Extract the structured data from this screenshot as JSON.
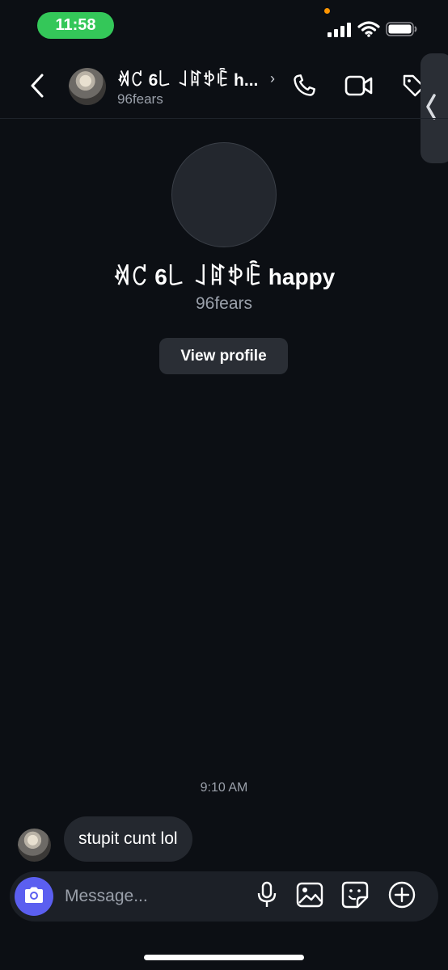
{
  "status_bar": {
    "time": "11:58"
  },
  "header": {
    "name": "ꄊ꒝ 6꒒ ꒑ꍏꉣꍟ h...",
    "chevron": "›",
    "username": "96fears",
    "icons": [
      "chevron-left-icon",
      "phone-icon",
      "video-icon",
      "tag-icon"
    ]
  },
  "profile": {
    "name": "ꄊ꒝ 6꒒ ꒑ꍏꉣꍟ happy",
    "username": "96fears",
    "view_profile_label": "View profile"
  },
  "conversation": {
    "timestamp": "9:10 AM",
    "messages": [
      {
        "text": "stupit cunt lol",
        "from": "other"
      }
    ]
  },
  "composer": {
    "placeholder": "Message...",
    "camera_color": "#5b5ff0",
    "icons": [
      "camera-icon",
      "microphone-icon",
      "image-icon",
      "sticker-icon",
      "plus-circle-icon"
    ]
  },
  "colors": {
    "background": "#0c0f14",
    "status_pill": "#34c759",
    "bubble": "#24282f"
  }
}
